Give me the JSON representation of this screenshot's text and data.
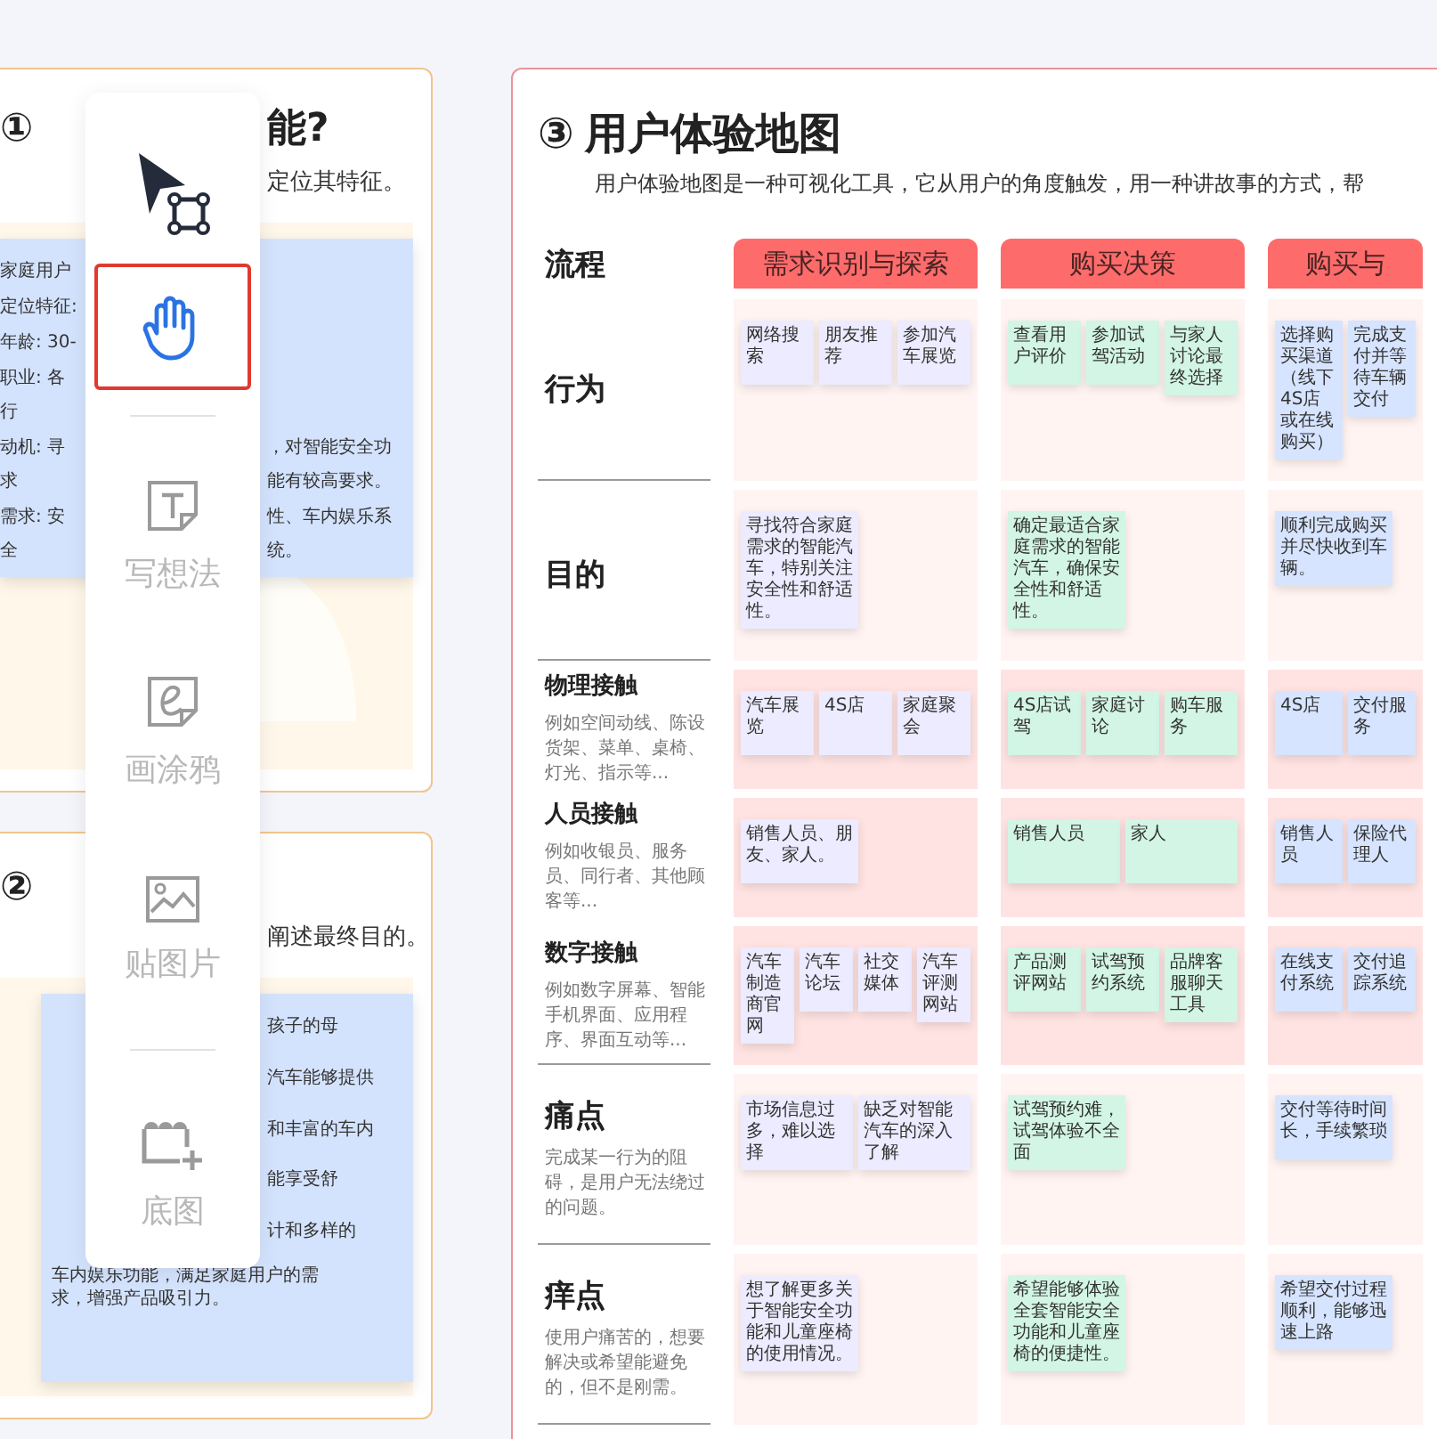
{
  "toolbar": {
    "tool_groups": [
      {
        "tools": [
          {
            "kind": "select",
            "selected": false
          },
          {
            "kind": "hand",
            "selected": true
          }
        ]
      },
      {
        "tools": [
          {
            "kind": "note",
            "label": "写想法",
            "selected": false
          },
          {
            "kind": "doodle",
            "label": "画涂鸦",
            "selected": false
          },
          {
            "kind": "image",
            "label": "贴图片",
            "selected": false
          }
        ]
      },
      {
        "tools": [
          {
            "kind": "frame",
            "label": "底图",
            "selected": false
          }
        ]
      }
    ]
  },
  "cards": [
    {
      "number": "①",
      "title": "能?",
      "subtitle": "定位其特征。",
      "kind": "persona",
      "note": {
        "rows": [
          {
            "left": "家庭用户"
          },
          {
            "left": "定位特征:"
          },
          {
            "left": "年龄: 30-"
          },
          {
            "left": "职业: 各行"
          },
          {
            "left": "动机: 寻求",
            "right": "，对智能安全功能有较高要求。"
          },
          {
            "left": "需求: 安全",
            "right": "性、车内娱乐系统。"
          }
        ]
      }
    },
    {
      "number": "②",
      "subtitle": "阐述最终目的。",
      "kind": "goal",
      "note": {
        "rows": [
          {
            "right": "孩子的母"
          },
          {
            "right": "汽车能够提供"
          },
          {
            "right": "和丰富的车内"
          },
          {
            "right": "能享受舒"
          },
          {
            "right": "计和多样的"
          }
        ],
        "lines": [
          "车内娱乐功能，满足家庭用户的需",
          "求，增强产品吸引力。"
        ]
      }
    }
  ],
  "map": {
    "number": "③",
    "title": "用户体验地图",
    "description": "用户体验地图是一种可视化工具，它从用户的角度触发，用一种讲故事的方式，帮",
    "label_header": "流程",
    "stages": [
      {
        "name": "需求识别与探索",
        "color": "#ecebff"
      },
      {
        "name": "购买决策",
        "color": "#d2f5e5"
      },
      {
        "name": "购买与",
        "color": "#d6e4ff"
      }
    ],
    "rows": [
      {
        "label": "行为",
        "kind": "stage",
        "cells": [
          [
            "网络搜索",
            "朋友推荐",
            "参加汽车展览"
          ],
          [
            "查看用户评价",
            "参加试驾活动",
            "与家人讨论最终选择"
          ],
          [
            "选择购买渠道（线下4S店或在线购买）",
            "完成支付并等待车辆交付"
          ]
        ]
      },
      {
        "label": "目的",
        "kind": "stage",
        "cells": [
          [
            "寻找符合家庭需求的智能汽车，特别关注安全性和舒适性。"
          ],
          [
            "确定最适合家庭需求的智能汽车，确保安全性和舒适性。"
          ],
          [
            "顺利完成购买并尽快收到车辆。"
          ]
        ]
      },
      {
        "label": "物理接触",
        "kind": "touchpoint",
        "description": "例如空间动线、陈设货架、菜单、桌椅、灯光、指示等...",
        "cells": [
          [
            "汽车展览",
            "4S店",
            "家庭聚会"
          ],
          [
            "4S店试驾",
            "家庭讨论",
            "购车服务"
          ],
          [
            "4S店",
            "交付服务"
          ]
        ]
      },
      {
        "label": "人员接触",
        "kind": "touchpoint",
        "description": "例如收银员、服务员、同行者、其他顾客等...",
        "cells": [
          [
            "销售人员、朋友、家人。"
          ],
          [
            "销售人员",
            "家人"
          ],
          [
            "销售人员",
            "保险代理人"
          ]
        ]
      },
      {
        "label": "数字接触",
        "kind": "touchpoint",
        "description": "例如数字屏幕、智能手机界面、应用程序、界面互动等...",
        "cells": [
          [
            "汽车制造商官网",
            "汽车论坛",
            "社交媒体",
            "汽车评测网站"
          ],
          [
            "产品测评网站",
            "试驾预约系统",
            "品牌客服聊天工具"
          ],
          [
            "在线支付系统",
            "交付追踪系统"
          ]
        ]
      },
      {
        "label": "痛点",
        "kind": "stage",
        "description": "完成某一行为的阻碍，是用户无法绕过的问题。",
        "cells": [
          [
            "市场信息过多，难以选择",
            "缺乏对智能汽车的深入了解"
          ],
          [
            "试驾预约难，试驾体验不全面"
          ],
          [
            "交付等待时间长，手续繁琐"
          ]
        ]
      },
      {
        "label": "痒点",
        "kind": "stage",
        "description": "使用户痛苦的，想要解决或希望能避免的，但不是刚需。",
        "cells": [
          [
            "想了解更多关于智能安全功能和儿童座椅的使用情况。"
          ],
          [
            "希望能够体验全套智能安全功能和儿童座椅的便捷性。"
          ],
          [
            "希望交付过程顺利，能够迅速上路"
          ]
        ]
      }
    ]
  }
}
